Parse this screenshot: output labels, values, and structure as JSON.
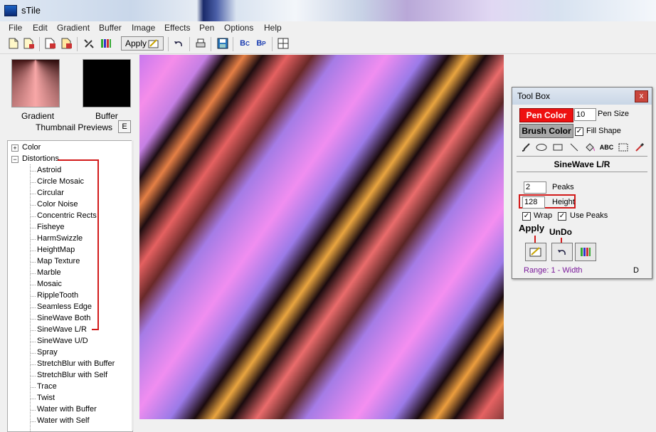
{
  "window": {
    "title": "sTile"
  },
  "menu": [
    "File",
    "Edit",
    "Gradient",
    "Buffer",
    "Image",
    "Effects",
    "Pen",
    "Options",
    "Help"
  ],
  "toolbar": {
    "apply_label": "Apply"
  },
  "thumbnails": {
    "gradient_label": "Gradient",
    "buffer_label": "Buffer",
    "previews_label": "Thumbnail Previews",
    "e_button": "E"
  },
  "tree": {
    "top_items": [
      {
        "label": "Color",
        "expander": "+"
      },
      {
        "label": "Distortions",
        "expander": "−"
      }
    ],
    "distortions": [
      "Astroid",
      "Circle Mosaic",
      "Circular",
      "Color Noise",
      "Concentric Rects",
      "Fisheye",
      "HarmSwizzle",
      "HeightMap",
      "Map Texture",
      "Marble",
      "Mosaic",
      "RippleTooth",
      "Seamless Edge",
      "SineWave Both",
      "SineWave L/R",
      "SineWave U/D",
      "Spray",
      "StretchBlur with Buffer",
      "StretchBlur with Self",
      "Trace",
      "Twist",
      "Water with Buffer",
      "Water with Self"
    ]
  },
  "toolbox": {
    "title": "Tool Box",
    "close": "x",
    "pen_color": "Pen Color",
    "pen_size_value": "10",
    "pen_size_label": "Pen Size",
    "brush_color": "Brush Color",
    "fill_shape_label": "Fill Shape",
    "fill_shape_checked": "✓",
    "mode_title": "SineWave L/R",
    "peaks_value": "2",
    "peaks_label": "Peaks",
    "height_value": "128",
    "height_label": "Height",
    "wrap_label": "Wrap",
    "use_peaks_label": "Use Peaks",
    "wrap_checked": "✓",
    "use_peaks_checked": "✓",
    "apply_callout": "Apply",
    "undo_callout": "UnDo",
    "range_label": "Range: 1 - Width",
    "range_d": "D",
    "text_tool": "ABC"
  },
  "colors": {
    "pen": "#ee1111",
    "brush": "#a8a8a8",
    "annotation": "#d21a1a"
  }
}
